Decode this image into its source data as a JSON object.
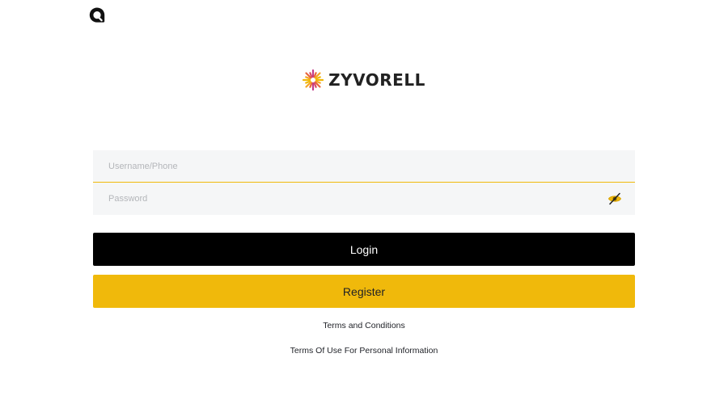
{
  "app": {
    "brand_name": "ZYVORELL",
    "corner_icon": "speech-bubble-icon",
    "brand_icon": "sunburst-logo-icon"
  },
  "form": {
    "username_placeholder": "Username/Phone",
    "username_value": "",
    "password_placeholder": "Password",
    "password_value": "",
    "password_toggle_icon": "eye-slash-icon"
  },
  "actions": {
    "login_label": "Login",
    "register_label": "Register"
  },
  "links": {
    "terms": "Terms and Conditions",
    "privacy": "Terms Of Use For Personal Information"
  },
  "colors": {
    "accent": "#f0b90b",
    "login_bg": "#000000",
    "field_bg": "#f5f6f7",
    "text": "#1e2026"
  }
}
